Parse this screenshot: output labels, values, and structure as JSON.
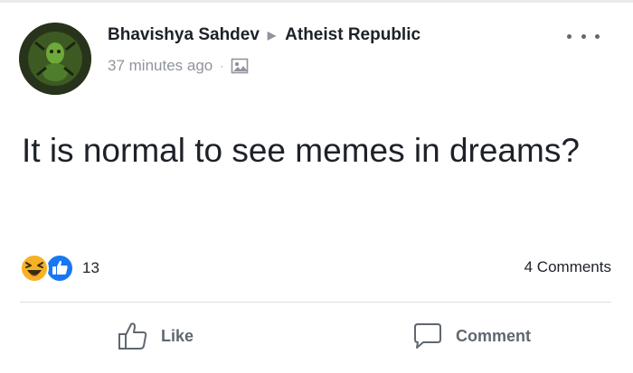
{
  "post": {
    "author": "Bhavishya Sahdev",
    "group": "Atheist Republic",
    "timestamp": "37 minutes ago",
    "separator": "·",
    "audience_icon": "public-photo-icon",
    "text": "It is normal to see memes in dreams?"
  },
  "reactions": {
    "types": [
      "haha",
      "like"
    ],
    "count": "13"
  },
  "comments": {
    "label": "4 Comments"
  },
  "actions": {
    "like_label": "Like",
    "comment_label": "Comment"
  },
  "colors": {
    "text": "#1d2129",
    "secondary": "#90949c",
    "action": "#606770",
    "like_blue": "#1877f2",
    "haha_yellow": "#f7b125"
  }
}
